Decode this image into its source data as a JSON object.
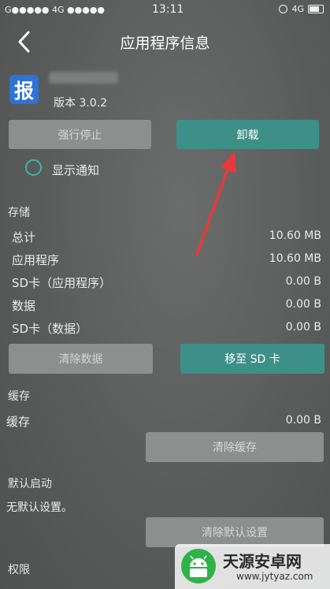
{
  "status_bar": {
    "carrier": "G●●●●● 4G ●●●●●",
    "time": "13:11",
    "network": "4G"
  },
  "header": {
    "title": "应用程序信息"
  },
  "app": {
    "icon_char": "报",
    "version": "版本 3.0.2"
  },
  "actions": {
    "force_stop": "强行停止",
    "uninstall": "卸载"
  },
  "notification": {
    "label": "显示通知"
  },
  "storage": {
    "heading": "存储",
    "rows": [
      {
        "label": "总计",
        "value": "10.60 MB"
      },
      {
        "label": "应用程序",
        "value": "10.60 MB"
      },
      {
        "label": "SD卡（应用程序）",
        "value": "0.00 B"
      },
      {
        "label": "数据",
        "value": "0.00 B"
      },
      {
        "label": "SD卡（数据）",
        "value": "0.00 B"
      }
    ],
    "clear_data": "清除数据",
    "move_to_sd": "移至 SD 卡"
  },
  "cache": {
    "heading": "缓存",
    "label": "缓存",
    "value": "0.00 B",
    "clear_cache": "清除缓存"
  },
  "default_launch": {
    "heading": "默认启动",
    "text": "无默认设置。",
    "clear_defaults": "清除默认设置"
  },
  "permissions": {
    "heading": "权限"
  },
  "watermark": {
    "title": "天源安卓网",
    "url": "www.jytyaz.com"
  },
  "colors": {
    "accent": "#3d9087",
    "arrow": "#e8393a",
    "background": "#5a5d5c"
  }
}
